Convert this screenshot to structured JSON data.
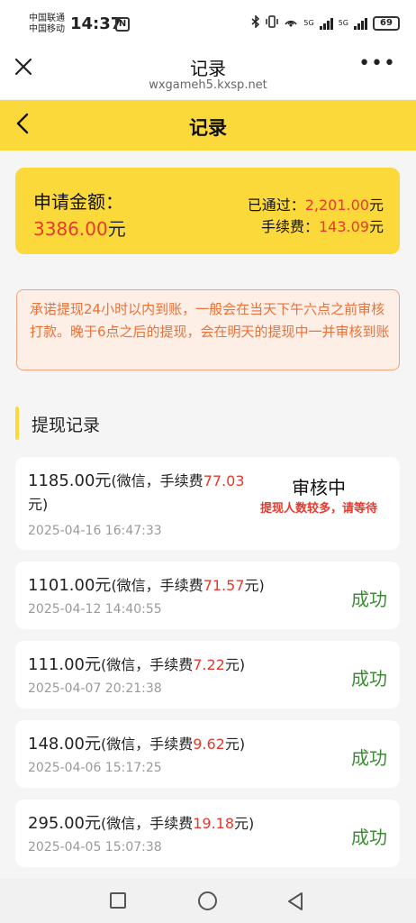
{
  "status_bar": {
    "carrier_1": "中国联通",
    "carrier_2": "中国移动",
    "time": "14:37",
    "network_1": "5G",
    "network_2": "5G",
    "battery": "69"
  },
  "browser": {
    "title": "记录",
    "url": "wxgameh5.kxsp.net"
  },
  "page": {
    "title": "记录"
  },
  "summary": {
    "apply_label": "申请金额：",
    "apply_value": "3386.00",
    "apply_unit": "元",
    "passed_label": "已通过：",
    "passed_value": "2,201.00",
    "passed_unit": "元",
    "fee_label": "手续费：",
    "fee_value": "143.09",
    "fee_unit": "元"
  },
  "notice": "承诺提现24小时以内到账，一般会在当天下午六点之前审核打款。晚于6点之后的提现，会在明天的提现中一并审核到账",
  "section_title": "提现记录",
  "records": [
    {
      "amount": "1185.00元",
      "detail_prefix": "(微信，手续费",
      "fee": "77.03",
      "detail_suffix": "元)",
      "time": "2025-04-16 16:47:33",
      "status": "审核中",
      "note": "提现人数较多，请等待"
    },
    {
      "amount": "1101.00元",
      "detail_prefix": "(微信，手续费",
      "fee": "71.57",
      "detail_suffix": "元)",
      "time": "2025-04-12 14:40:55",
      "status": "成功"
    },
    {
      "amount": "111.00元",
      "detail_prefix": "(微信，手续费",
      "fee": "7.22",
      "detail_suffix": "元)",
      "time": "2025-04-07 20:21:38",
      "status": "成功"
    },
    {
      "amount": "148.00元",
      "detail_prefix": "(微信，手续费",
      "fee": "9.62",
      "detail_suffix": "元)",
      "time": "2025-04-06 15:17:25",
      "status": "成功"
    },
    {
      "amount": "295.00元",
      "detail_prefix": "(微信，手续费",
      "fee": "19.18",
      "detail_suffix": "元)",
      "time": "2025-04-05 15:07:38",
      "status": "成功"
    }
  ],
  "colors": {
    "accent_yellow": "#fbd93b",
    "amount_red": "#e53a2c",
    "success_green": "#3c8c33",
    "notice_orange": "#e8723a"
  },
  "icons": {
    "close": "close-icon",
    "more": "more-icon",
    "back": "back-arrow-icon",
    "nav_recent": "square-icon",
    "nav_home": "circle-icon",
    "nav_back": "triangle-back-icon"
  }
}
